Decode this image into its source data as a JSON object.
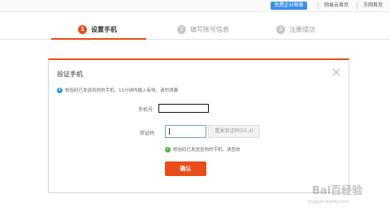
{
  "topbar": {
    "register_email_btn": "免费企业邮箱",
    "link_netease_home": "网易云首页",
    "link_wanwang_home": "万网首页"
  },
  "steps": [
    {
      "num": "1",
      "label": "设置手机",
      "state": "active"
    },
    {
      "num": "2",
      "label": "填写账号信息",
      "state": "todo"
    },
    {
      "num": "3",
      "label": "注册成功",
      "state": "todo"
    }
  ],
  "dialog": {
    "title": "验证手机",
    "notice": "校验码已发送到你的手机，15分钟内输入有效，请勿泄漏",
    "phone_label": "手机号",
    "code_label": "验证码",
    "resend_label": "重发验证码(55 s)",
    "sent_msg": "校验码已发送至你的手机，请查收",
    "confirm_label": "确认"
  },
  "watermark": {
    "logo": "Bai百经验",
    "sub": "jingyan.baidu.com"
  },
  "colors": {
    "accent": "#e94d19",
    "info": "#2b9be0",
    "success": "#4db84a",
    "top_button": "#3a8ee6"
  }
}
